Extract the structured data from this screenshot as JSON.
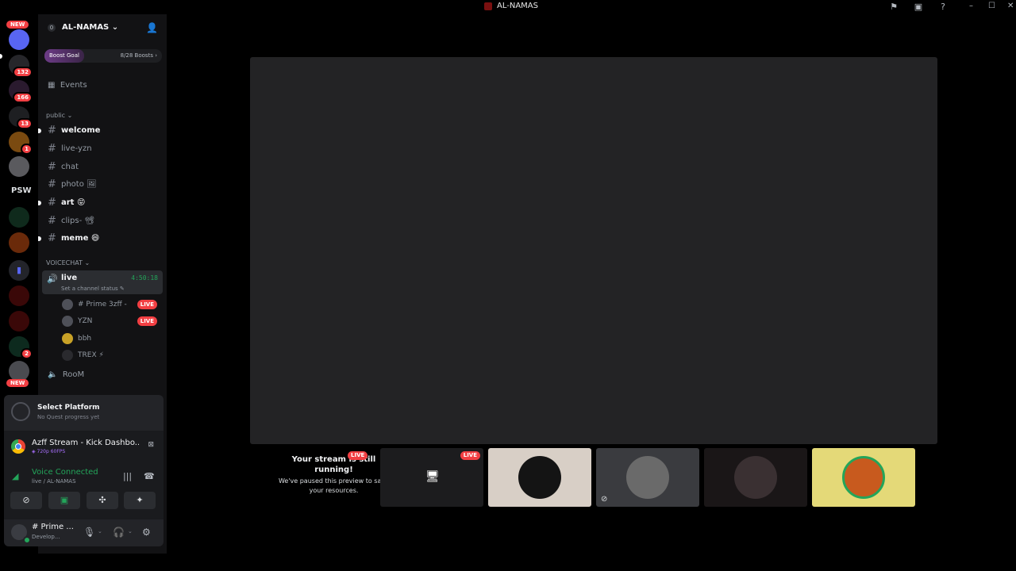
{
  "window": {
    "title": "AL-NAMAS",
    "icons": [
      "flag-icon",
      "inbox-icon",
      "help-icon"
    ],
    "controls": {
      "minimize": "–",
      "maximize": "☐",
      "close": "✕"
    }
  },
  "rail": {
    "new_top": "NEW",
    "new_bottom": "NEW",
    "badges": [
      "132",
      "166",
      "13",
      "1",
      "2"
    ],
    "psw_label": "PSW"
  },
  "guild": {
    "dot": "0",
    "name": "AL-NAMAS",
    "boost_label": "Boost Goal",
    "boost_count": "8/28 Boosts"
  },
  "sidebar": {
    "events": "Events",
    "category_public": "public",
    "category_voice": "VOICECHAT",
    "channels": [
      {
        "name": "welcome",
        "unread": true
      },
      {
        "name": "live-yzn",
        "unread": false
      },
      {
        "name": "chat",
        "unread": false
      },
      {
        "name": "photo 🖼",
        "unread": false
      },
      {
        "name": "art 😝",
        "unread": true
      },
      {
        "name": "clips- 📽",
        "unread": false
      },
      {
        "name": "meme 😄",
        "unread": true
      }
    ],
    "voice_channel": {
      "name": "live",
      "timer": "4:50:18",
      "status": "Set a channel status"
    },
    "voice_users": [
      {
        "name": "# Prime 3zff - ",
        "live": "LIVE"
      },
      {
        "name": "YZN",
        "live": "LIVE"
      },
      {
        "name": "bbh"
      },
      {
        "name": "TREX ⚡"
      }
    ],
    "room": "RooM"
  },
  "quest": {
    "title": "Select Platform",
    "subtitle": "No Quest progress yet"
  },
  "activity": {
    "title": "Azff Stream - Kick Dashbo...",
    "subtitle": "720p 60FPS"
  },
  "voice": {
    "status": "Voice Connected",
    "location": "live / AL-NAMAS"
  },
  "user": {
    "name": "# Prime ...",
    "status": "Develop..."
  },
  "stream": {
    "paused_title": "Your stream is still running!",
    "paused_body": "We've paused this preview to save your resources.",
    "live": "LIVE",
    "tile_live": "LIVE"
  },
  "colors": {
    "accent_green": "#23a55a",
    "live_red": "#f23f43",
    "stage_bg": "#232325"
  }
}
